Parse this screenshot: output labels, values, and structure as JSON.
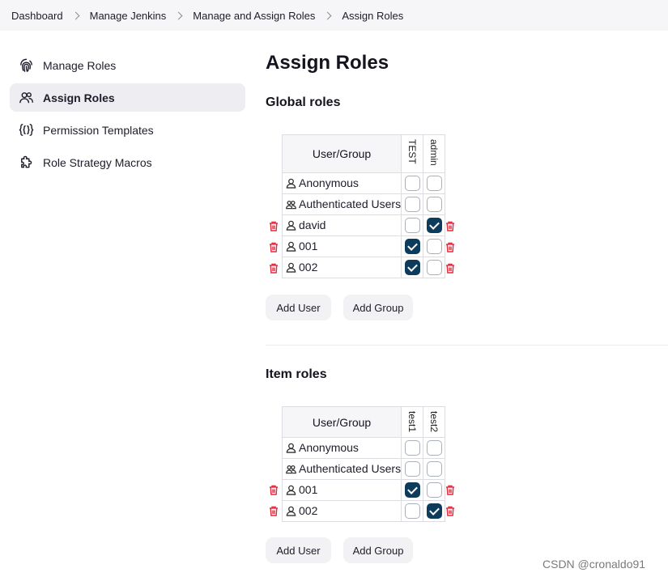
{
  "breadcrumbs": [
    "Dashboard",
    "Manage Jenkins",
    "Manage and Assign Roles",
    "Assign Roles"
  ],
  "sidebar": {
    "items": [
      {
        "label": "Manage Roles",
        "icon": "fingerprint-icon",
        "active": false
      },
      {
        "label": "Assign Roles",
        "icon": "users-icon",
        "active": true
      },
      {
        "label": "Permission Templates",
        "icon": "braces-icon",
        "active": false
      },
      {
        "label": "Role Strategy Macros",
        "icon": "puzzle-icon",
        "active": false
      }
    ]
  },
  "page": {
    "title": "Assign Roles"
  },
  "global_roles": {
    "heading": "Global roles",
    "header": "User/Group",
    "roles": [
      "TEST",
      "admin"
    ],
    "rows": [
      {
        "name": "Anonymous",
        "icon": "user-icon",
        "checks": [
          false,
          false
        ],
        "deletable": false
      },
      {
        "name": "Authenticated Users",
        "icon": "users-icon",
        "checks": [
          false,
          false
        ],
        "deletable": false
      },
      {
        "name": "david",
        "icon": "user-icon",
        "checks": [
          false,
          true
        ],
        "deletable": true
      },
      {
        "name": "001",
        "icon": "user-icon",
        "checks": [
          true,
          false
        ],
        "deletable": true
      },
      {
        "name": "002",
        "icon": "user-icon",
        "checks": [
          true,
          false
        ],
        "deletable": true
      }
    ],
    "add_user": "Add User",
    "add_group": "Add Group"
  },
  "item_roles": {
    "heading": "Item roles",
    "header": "User/Group",
    "roles": [
      "test1",
      "test2"
    ],
    "rows": [
      {
        "name": "Anonymous",
        "icon": "user-icon",
        "checks": [
          false,
          false
        ],
        "deletable": false
      },
      {
        "name": "Authenticated Users",
        "icon": "users-icon",
        "checks": [
          false,
          false
        ],
        "deletable": false
      },
      {
        "name": "001",
        "icon": "user-icon",
        "checks": [
          true,
          false
        ],
        "deletable": true
      },
      {
        "name": "002",
        "icon": "user-icon",
        "checks": [
          false,
          true
        ],
        "deletable": true
      }
    ],
    "add_user": "Add User",
    "add_group": "Add Group"
  },
  "colors": {
    "checked": "#0c3b5c",
    "delete": "#e0283a",
    "active_item": "#ededf2"
  },
  "watermark": "CSDN @cronaldo91"
}
